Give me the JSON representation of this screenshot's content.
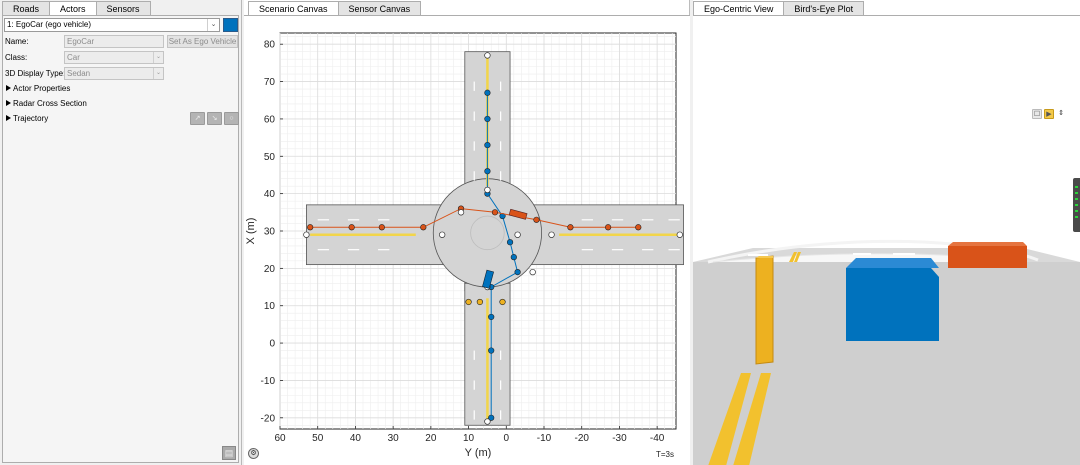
{
  "left_panel": {
    "tabs": [
      {
        "label": "Roads",
        "active": false
      },
      {
        "label": "Actors",
        "active": true
      },
      {
        "label": "Sensors",
        "active": false
      }
    ],
    "actor_select": "1: EgoCar (ego vehicle)",
    "actor_color": "#0072bd",
    "name_label": "Name:",
    "name_value": "EgoCar",
    "set_ego_button": "Set As Ego Vehicle",
    "class_label": "Class:",
    "class_value": "Car",
    "display_type_label": "3D Display Type:",
    "display_type_value": "Sedan",
    "sections": [
      "Actor Properties",
      "Radar Cross Section",
      "Trajectory"
    ]
  },
  "middle_panel": {
    "tabs": [
      {
        "label": "Scenario Canvas",
        "active": true
      },
      {
        "label": "Sensor Canvas",
        "active": false
      }
    ],
    "time_label": "T=3s"
  },
  "right_panel": {
    "tabs": [
      {
        "label": "Ego-Centric View",
        "active": true
      },
      {
        "label": "Bird's-Eye Plot",
        "active": false
      }
    ]
  },
  "chart_data": {
    "type": "scatter",
    "xlabel": "Y (m)",
    "ylabel": "X (m)",
    "xlim": [
      60,
      -45
    ],
    "ylim": [
      -23,
      83
    ],
    "x_ticks": [
      60,
      50,
      40,
      30,
      20,
      10,
      0,
      -10,
      -20,
      -30,
      -40
    ],
    "y_ticks": [
      80,
      70,
      60,
      50,
      40,
      30,
      20,
      10,
      0,
      -10,
      -20
    ],
    "grid": true,
    "series": [
      {
        "color": "#0072bd",
        "points": [
          [
            5,
            67
          ],
          [
            5,
            60
          ],
          [
            5,
            53
          ],
          [
            5,
            46
          ],
          [
            5,
            40
          ],
          [
            1,
            34
          ],
          [
            -1,
            27
          ],
          [
            -2,
            23
          ],
          [
            -3,
            19
          ],
          [
            4,
            15
          ],
          [
            4,
            7
          ],
          [
            4,
            -2
          ],
          [
            4,
            -20
          ]
        ]
      },
      {
        "color": "#d95319",
        "points": [
          [
            52,
            31
          ],
          [
            41,
            31
          ],
          [
            33,
            31
          ],
          [
            22,
            31
          ],
          [
            12,
            36
          ],
          [
            3,
            35
          ],
          [
            -8,
            33
          ],
          [
            -17,
            31
          ],
          [
            -27,
            31
          ],
          [
            -35,
            31
          ]
        ]
      },
      {
        "color": "#edb120",
        "points": [
          [
            10,
            11
          ],
          [
            7,
            11
          ],
          [
            1,
            11
          ]
        ]
      }
    ],
    "colors": {
      "ego": "#0072bd",
      "vehicle2": "#d95319",
      "vehicle3": "#edb120",
      "road": "#d4d4d4",
      "lane_yellow": "#f2d54a"
    }
  }
}
